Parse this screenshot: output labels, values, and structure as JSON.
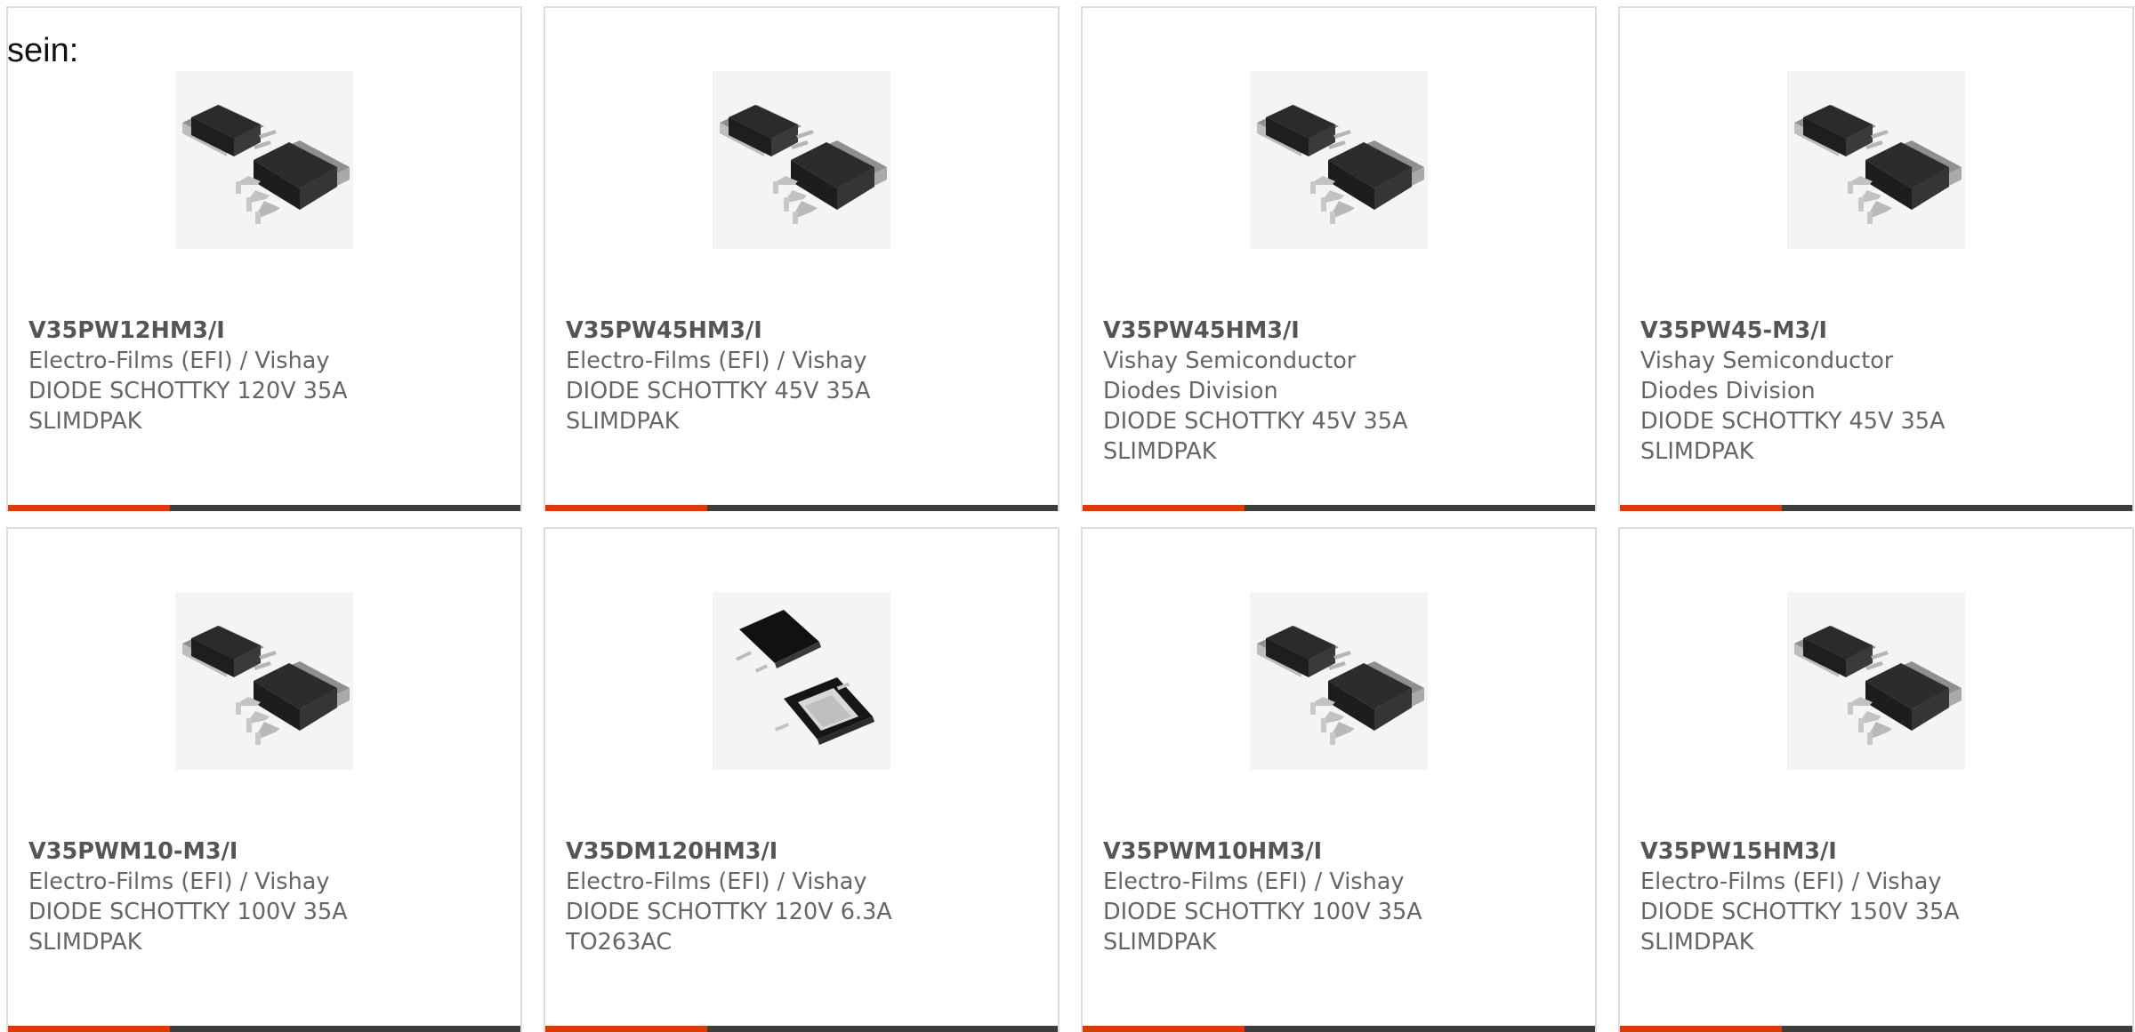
{
  "intro_text": "sein:",
  "colors": {
    "accent": "#dd3a0a",
    "bar_dark": "#3d3d3d",
    "text_gray": "#666666",
    "card_border": "#dddddd"
  },
  "products": [
    {
      "part_number": "V35PW12HM3/I",
      "manufacturer": "Electro-Films (EFI) / Vishay",
      "description_line1": "DIODE SCHOTTKY 120V 35A",
      "description_line2": "SLIMDPAK",
      "image_icon": "slimdpak-package-icon"
    },
    {
      "part_number": "V35PW45HM3/I",
      "manufacturer": "Electro-Films (EFI) / Vishay",
      "description_line1": "DIODE SCHOTTKY 45V 35A",
      "description_line2": "SLIMDPAK",
      "image_icon": "slimdpak-package-icon"
    },
    {
      "part_number": "V35PW45HM3/I",
      "manufacturer": "Vishay Semiconductor Diodes Division",
      "description_line1": "DIODE SCHOTTKY 45V 35A",
      "description_line2": "SLIMDPAK",
      "image_icon": "slimdpak-package-icon"
    },
    {
      "part_number": "V35PW45-M3/I",
      "manufacturer": "Vishay Semiconductor Diodes Division",
      "description_line1": "DIODE SCHOTTKY 45V 35A",
      "description_line2": "SLIMDPAK",
      "image_icon": "slimdpak-package-icon"
    },
    {
      "part_number": "V35PWM10-M3/I",
      "manufacturer": "Electro-Films (EFI) / Vishay",
      "description_line1": "DIODE SCHOTTKY 100V 35A",
      "description_line2": "SLIMDPAK",
      "image_icon": "slimdpak-package-icon"
    },
    {
      "part_number": "V35DM120HM3/I",
      "manufacturer": "Electro-Films (EFI) / Vishay",
      "description_line1": "DIODE SCHOTTKY 120V 6.3A",
      "description_line2": "TO263AC",
      "image_icon": "to263ac-package-icon"
    },
    {
      "part_number": "V35PWM10HM3/I",
      "manufacturer": "Electro-Films (EFI) / Vishay",
      "description_line1": "DIODE SCHOTTKY 100V 35A",
      "description_line2": "SLIMDPAK",
      "image_icon": "slimdpak-package-icon"
    },
    {
      "part_number": "V35PW15HM3/I",
      "manufacturer": "Electro-Films (EFI) / Vishay",
      "description_line1": "DIODE SCHOTTKY 150V 35A",
      "description_line2": "SLIMDPAK",
      "image_icon": "slimdpak-package-icon"
    }
  ]
}
